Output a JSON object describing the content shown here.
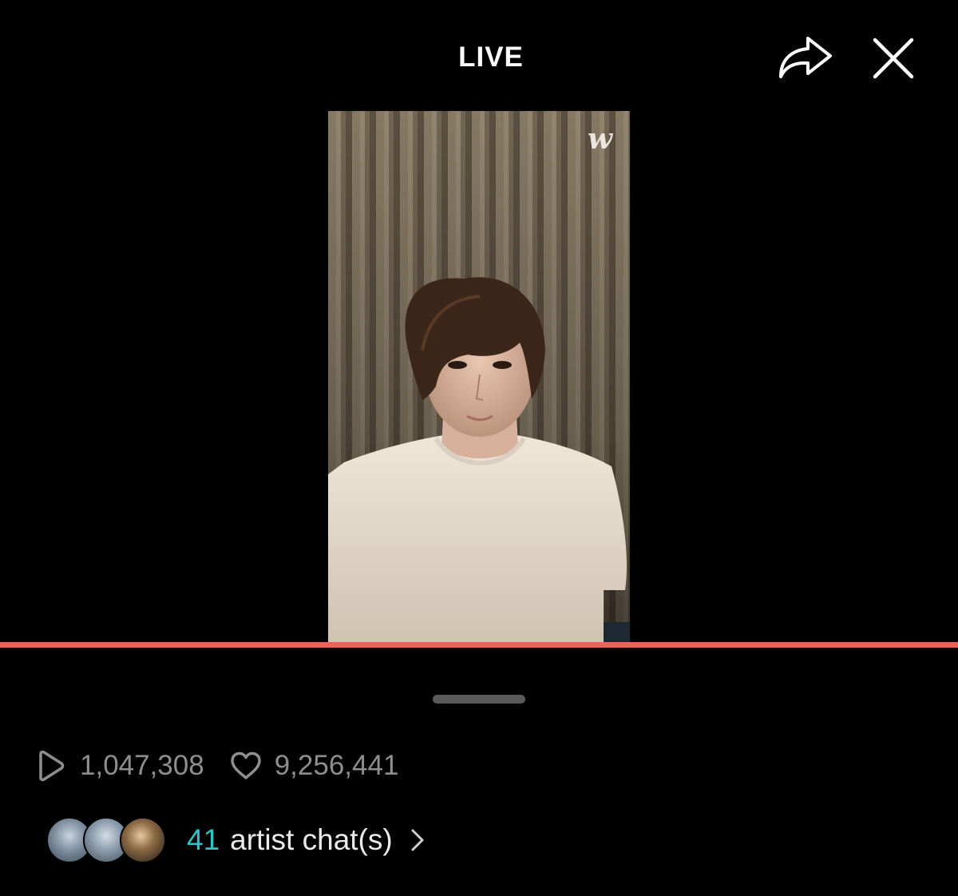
{
  "header": {
    "title": "LIVE"
  },
  "video": {
    "watermark": "w"
  },
  "progress": {
    "fraction": 1.0,
    "color": "#f0605c"
  },
  "stats": {
    "views": "1,047,308",
    "likes": "9,256,441"
  },
  "artist_chat": {
    "count": "41",
    "label": "artist chat(s)",
    "accent_color": "#2ec4c1"
  },
  "icons": {
    "share": "share-arrow-icon",
    "close": "close-icon",
    "views": "play-icon",
    "likes": "heart-icon",
    "chevron": "chevron-right-icon"
  }
}
